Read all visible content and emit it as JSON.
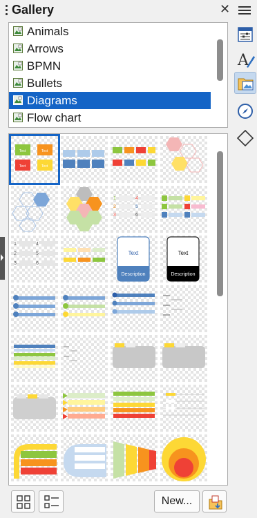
{
  "panel": {
    "title": "Gallery"
  },
  "themes": {
    "items": [
      {
        "label": "Animals"
      },
      {
        "label": "Arrows"
      },
      {
        "label": "BPMN"
      },
      {
        "label": "Bullets"
      },
      {
        "label": "Diagrams",
        "selected": true
      },
      {
        "label": "Flow chart"
      }
    ]
  },
  "thumb_text": {
    "text": "Text",
    "description": "Description"
  },
  "toolbar": {
    "new_label": "New..."
  },
  "icons": {
    "close": "close-icon",
    "menu": "hamburger-menu-icon",
    "properties": "properties-icon",
    "styles": "styles-icon",
    "gallery": "gallery-icon",
    "navigator": "navigator-icon",
    "shapes": "shapes-icon",
    "icon_view": "icon-view-icon",
    "detailed_view": "detailed-view-icon",
    "theme_properties": "theme-properties-icon"
  },
  "colors": {
    "selection": "#1464c6",
    "sidebar_active": "#c5d9ef"
  }
}
